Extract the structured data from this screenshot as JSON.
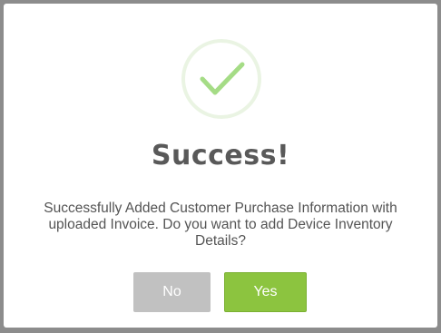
{
  "dialog": {
    "icon": "checkmark-icon",
    "title": "Success!",
    "message": "Successfully Added Customer Purchase Information with uploaded Invoice. Do you want to add Device Inventory Details?",
    "buttons": {
      "no_label": "No",
      "yes_label": "Yes"
    }
  },
  "colors": {
    "backdrop": "#8c8c8c",
    "modal_background": "#ffffff",
    "success_green": "#a5dc86",
    "yes_button": "#8cc43f",
    "no_button": "#c1c1c1",
    "title_text": "#595959",
    "message_text": "#545454"
  }
}
